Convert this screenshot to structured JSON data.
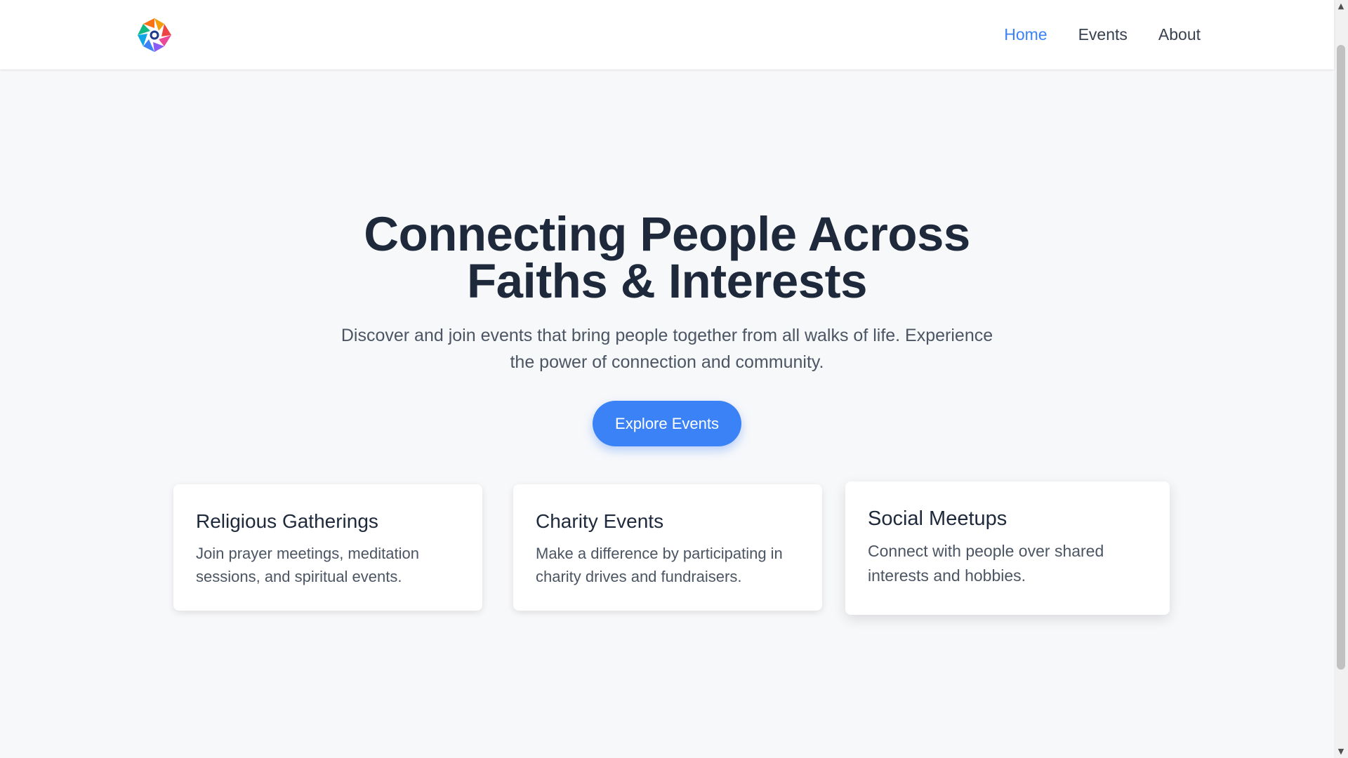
{
  "nav": {
    "logo_icon": "colorful-star-logo-icon",
    "items": [
      {
        "label": "Home",
        "active": true
      },
      {
        "label": "Events",
        "active": false
      },
      {
        "label": "About",
        "active": false
      }
    ]
  },
  "hero": {
    "title_line1": "Connecting People Across",
    "title_line2": "Faiths & Interests",
    "subtitle": "Discover and join events that bring people together from all walks of life. Experience the power of connection and community.",
    "cta_label": "Explore Events"
  },
  "cards": [
    {
      "title": "Religious Gatherings",
      "description": "Join prayer meetings, meditation sessions, and spiritual events."
    },
    {
      "title": "Charity Events",
      "description": "Make a difference by participating in charity drives and fundraisers."
    },
    {
      "title": "Social Meetups",
      "description": "Connect with people over shared interests and hobbies."
    }
  ],
  "colors": {
    "accent": "#3b82f6",
    "heading": "#1e293b",
    "body_text": "#4b5563",
    "background": "#f7f8fa"
  }
}
